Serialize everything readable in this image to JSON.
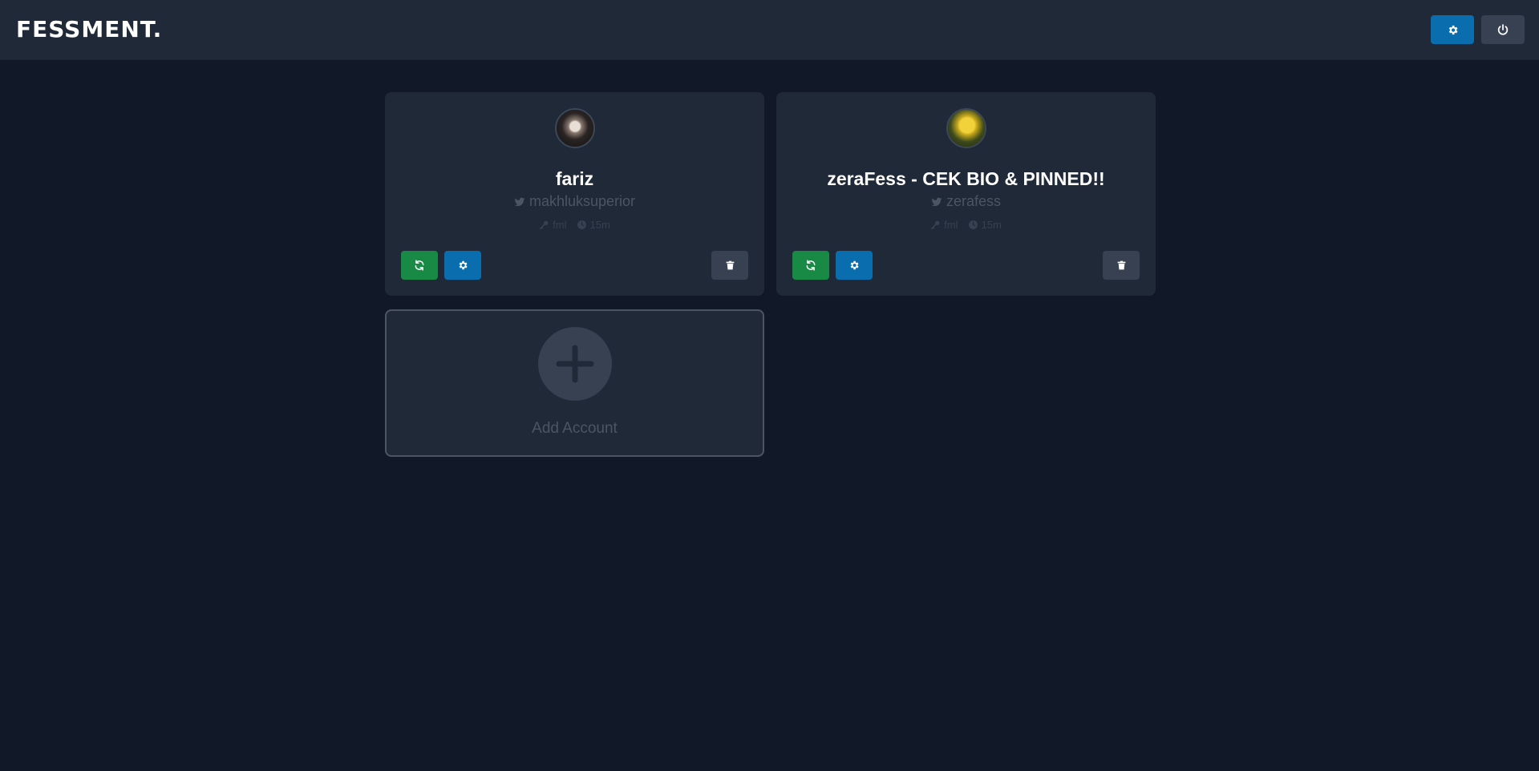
{
  "app": {
    "brand": "FESSMENT."
  },
  "header": {
    "settings_icon": "gear-icon",
    "logout_icon": "power-icon"
  },
  "accounts": [
    {
      "name": "fariz",
      "handle": "makhluksuperior",
      "mode": "fml",
      "interval": "15m",
      "avatar_icon": "avatar-image"
    },
    {
      "name": "zeraFess - CEK BIO & PINNED!!",
      "handle": "zerafess",
      "mode": "fml",
      "interval": "15m",
      "avatar_icon": "avatar-image"
    }
  ],
  "add_account": {
    "label": "Add Account"
  },
  "colors": {
    "background": "#111827",
    "surface": "#1f2937",
    "primary_blue": "#0a6eae",
    "success_green": "#198a46",
    "neutral_gray": "#374151"
  }
}
